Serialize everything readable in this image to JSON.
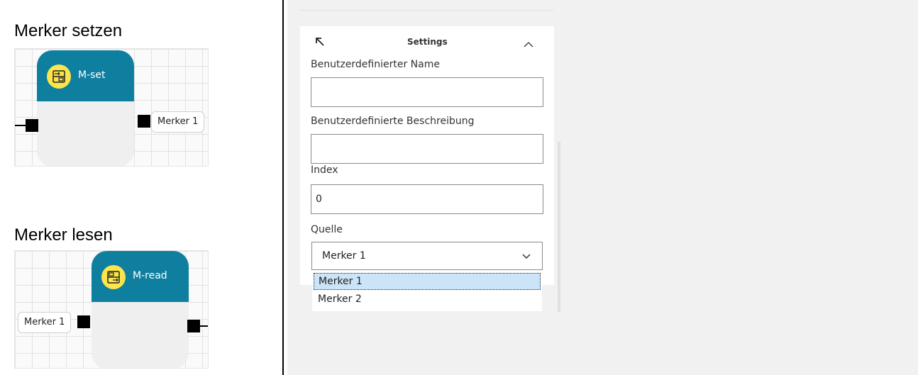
{
  "left": {
    "set_section": {
      "heading": "Merker setzen",
      "node_title": "M-set",
      "output_label": "Merker 1",
      "node_icon": "flag-set-icon"
    },
    "read_section": {
      "heading": "Merker lesen",
      "node_title": "M-read",
      "input_label": "Merker 1",
      "node_icon": "flag-read-icon"
    }
  },
  "panel": {
    "title": "Settings",
    "icons": {
      "back": "arrow-up-left-icon",
      "collapse": "chevron-up-icon"
    },
    "fields": {
      "custom_name": {
        "label": "Benutzerdefinierter Name",
        "value": ""
      },
      "custom_description": {
        "label": "Benutzerdefinierte Beschreibung",
        "value": ""
      },
      "index": {
        "label": "Index",
        "value": "0"
      },
      "source": {
        "label": "Quelle",
        "value": "Merker 1"
      }
    },
    "dropdown_options": [
      "Merker 1",
      "Merker 2"
    ],
    "selected_option": "Merker 1"
  },
  "colors": {
    "node_header": "#0f7fa0",
    "node_icon_bg": "#fbe54a",
    "selection": "#cce4f7",
    "panel_bg": "#f1f1f1"
  }
}
